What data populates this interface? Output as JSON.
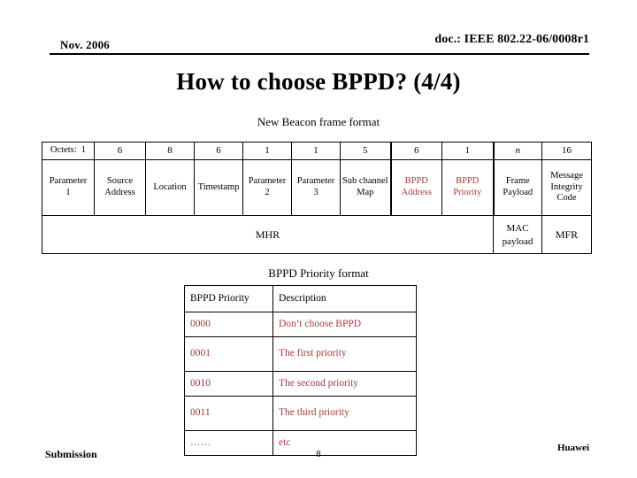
{
  "header": {
    "date": "Nov. 2006",
    "doc": "doc.: IEEE 802.22-06/0008r1"
  },
  "title": "How to choose BPPD? (4/4)",
  "beacon_frame": {
    "caption": "New Beacon frame format",
    "octet_label": "Octets:",
    "octet_sizes": [
      "1",
      "6",
      "8",
      "6",
      "1",
      "1",
      "5",
      "6",
      "1",
      "n",
      "16"
    ],
    "fields": [
      "Parameter 1",
      "Source Address",
      "Location",
      "Timestamp",
      "Parameter 2",
      "Parameter 3",
      "Sub channel Map",
      "BPPD Address",
      "BPPD Priority",
      "Frame Payload",
      "Message Integrity Code"
    ],
    "field_lines": [
      [
        "Parameter",
        "1"
      ],
      [
        "Source",
        "Address"
      ],
      [
        "Location"
      ],
      [
        "Timestamp"
      ],
      [
        "Parameter",
        "2"
      ],
      [
        "Parameter",
        "3"
      ],
      [
        "Sub channel",
        "Map"
      ],
      [
        "BPPD",
        "Address"
      ],
      [
        "BPPD",
        "Priority"
      ],
      [
        "Frame",
        "Payload"
      ],
      [
        "Message",
        "Integrity",
        "Code"
      ]
    ],
    "groups": {
      "mhr": "MHR",
      "mac_payload_line1": "MAC",
      "mac_payload_line2": "payload",
      "mfr": "MFR"
    },
    "highlight_color": "#A33A3A"
  },
  "priority_table": {
    "caption": "BPPD Priority format",
    "columns": [
      "BPPD Priority",
      "Description"
    ],
    "rows": [
      {
        "code": "0000",
        "description": "Don’t choose BPPD"
      },
      {
        "code": "0001",
        "description": "The first priority"
      },
      {
        "code": "0010",
        "description": "The second priority"
      },
      {
        "code": "0011",
        "description": "The third priority"
      },
      {
        "code": "……",
        "description": "etc"
      }
    ]
  },
  "footer": {
    "submission": "Submission",
    "page": "8",
    "company": "Huawei"
  }
}
